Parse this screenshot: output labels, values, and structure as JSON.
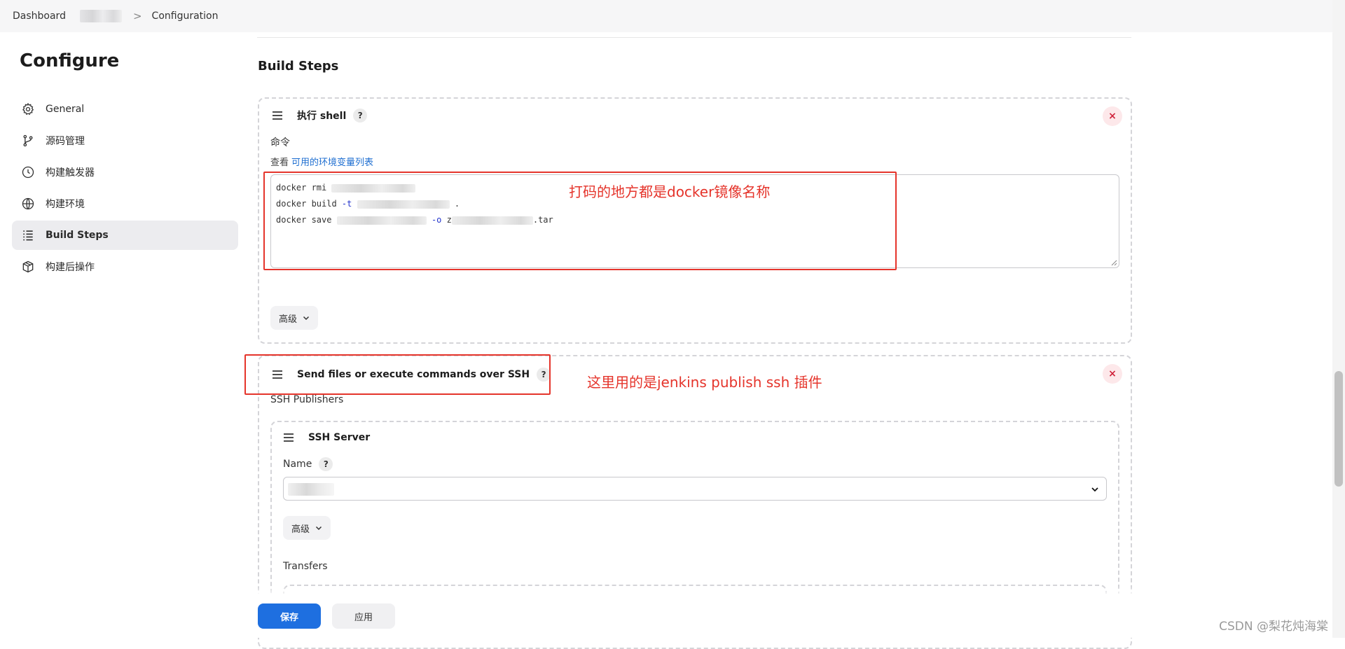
{
  "breadcrumb": {
    "dashboard": "Dashboard",
    "separator": ">",
    "configuration": "Configuration"
  },
  "sidebar": {
    "title": "Configure",
    "items": [
      {
        "label": "General",
        "icon": "gear-icon"
      },
      {
        "label": "源码管理",
        "icon": "branch-icon"
      },
      {
        "label": "构建触发器",
        "icon": "clock-icon"
      },
      {
        "label": "构建环境",
        "icon": "globe-icon"
      },
      {
        "label": "Build Steps",
        "icon": "list-icon",
        "active": true
      },
      {
        "label": "构建后操作",
        "icon": "package-icon"
      }
    ]
  },
  "main": {
    "section_title": "Build Steps",
    "shell_step": {
      "title": "执行 shell",
      "help": "?",
      "close": "×",
      "command_label": "命令",
      "env_prefix": "查看",
      "env_link": "可用的环境变量列表",
      "code": {
        "line1_cmd": "docker rmi ",
        "line2_cmd": "docker build ",
        "line2_flag": "-t",
        "line2_tail": " .",
        "line3_cmd": "docker save ",
        "line3_flag": "-o",
        "line3_prefix": " z",
        "line3_tail": ".tar"
      },
      "advanced_label": "高级"
    },
    "ssh_step": {
      "title": "Send files or execute commands over SSH",
      "help": "?",
      "close": "×",
      "publishers_label": "SSH Publishers",
      "server": {
        "title": "SSH Server",
        "name_label": "Name",
        "name_help": "?",
        "advanced_label": "高级",
        "transfers_label": "Transfers"
      }
    }
  },
  "actions": {
    "save": "保存",
    "apply": "应用"
  },
  "annotations": {
    "shell_note": "打码的地方都是docker镜像名称",
    "ssh_note": "这里用的是jenkins publish ssh 插件"
  },
  "watermark": "CSDN @梨花炖海棠",
  "colors": {
    "primary": "#1e6fe0",
    "annotation": "#e5342b",
    "link": "#1f6fd1",
    "close": "#d0233b"
  }
}
